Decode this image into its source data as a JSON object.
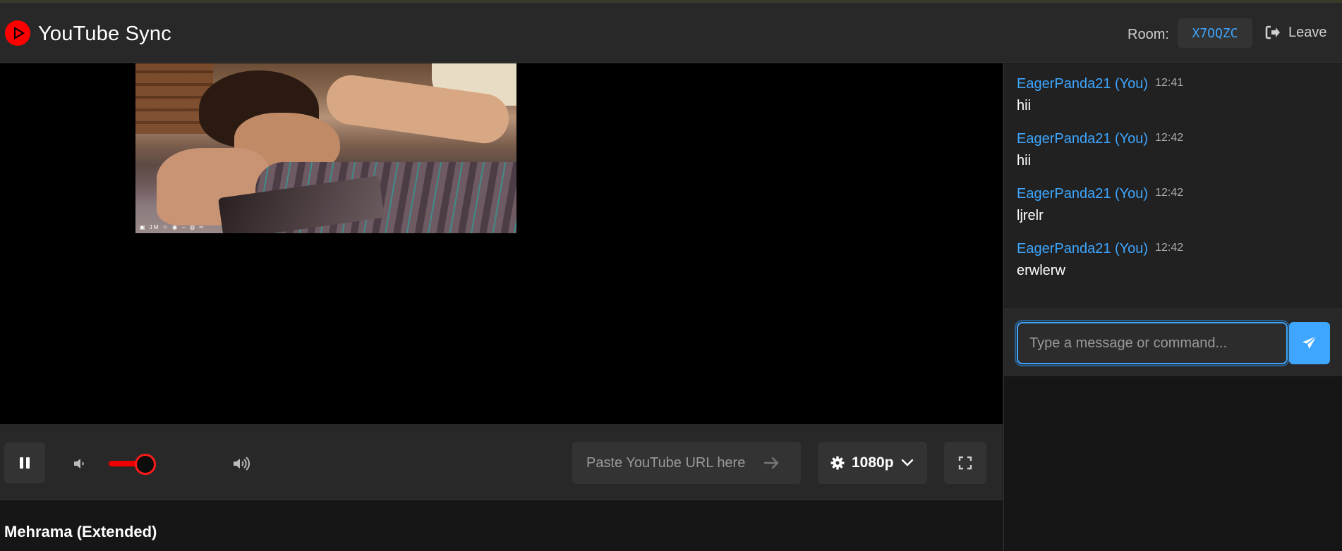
{
  "app": {
    "title": "YouTube Sync",
    "logo_icon": "youtube-play-icon"
  },
  "header": {
    "room_label": "Room:",
    "room_code": "X7OQZC",
    "leave_label": "Leave",
    "leave_icon": "sign-out-icon"
  },
  "player": {
    "is_playing": true,
    "volume_fraction": 0.35,
    "url_placeholder": "Paste YouTube URL here",
    "quality_label": "1080p",
    "title": "Mehrama (Extended)",
    "thumbnail_logos": "▣ JM ☆ ◉ ─ ◍ ═"
  },
  "chat": {
    "messages": [
      {
        "author": "EagerPanda21 (You)",
        "time": "12:41",
        "text": "hii"
      },
      {
        "author": "EagerPanda21 (You)",
        "time": "12:42",
        "text": "hii"
      },
      {
        "author": "EagerPanda21 (You)",
        "time": "12:42",
        "text": "ljrelr"
      },
      {
        "author": "EagerPanda21 (You)",
        "time": "12:42",
        "text": "erwlerw"
      }
    ],
    "input_placeholder": "Type a message or command..."
  },
  "colors": {
    "accent": "#3ea6ff",
    "brand_red": "#ff0000",
    "panel": "#282828",
    "background": "#161616"
  }
}
